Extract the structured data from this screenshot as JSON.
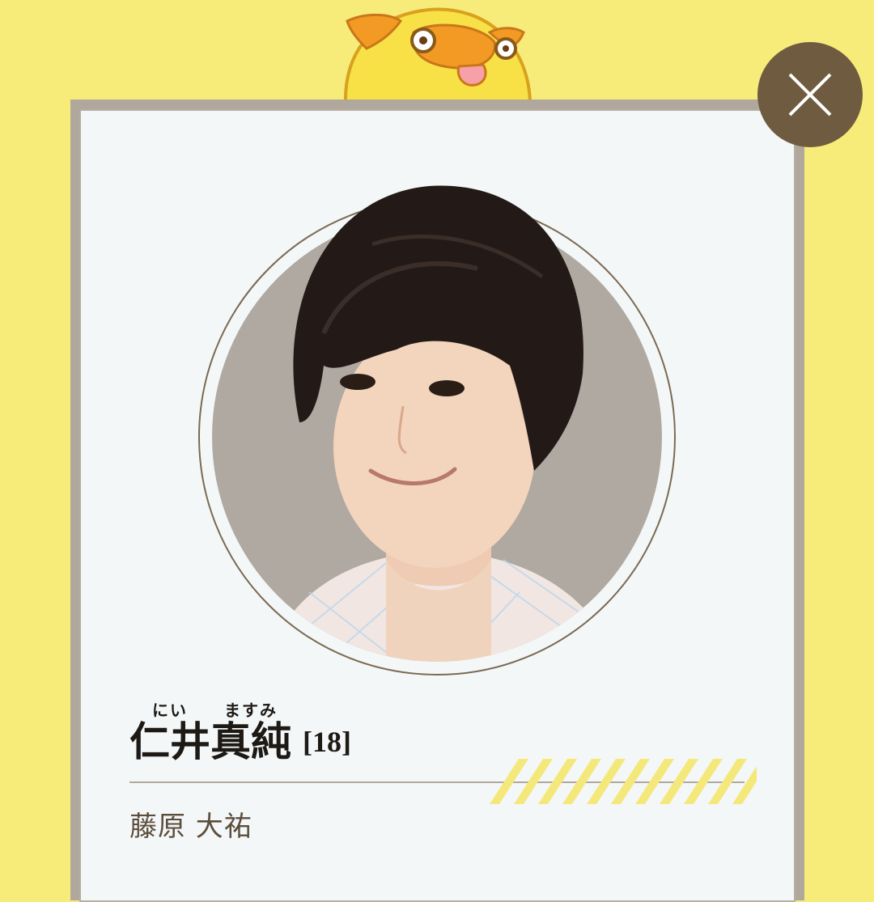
{
  "profile": {
    "character_name_parts": [
      {
        "kanji": "仁井",
        "reading": "にい"
      },
      {
        "kanji": "真純",
        "reading": "ますみ"
      }
    ],
    "age": "[18]",
    "actor_name": "藤原 大祐"
  },
  "icons": {
    "close": "close-icon",
    "mascot": "duck-mascot-icon"
  },
  "colors": {
    "background": "#f7eb7a",
    "card": "#f4f7f8",
    "close_button": "#6f5c40",
    "accent_stripes": "#f5e87a",
    "name_text": "#1d1a16",
    "actor_text": "#5b4d3c"
  }
}
